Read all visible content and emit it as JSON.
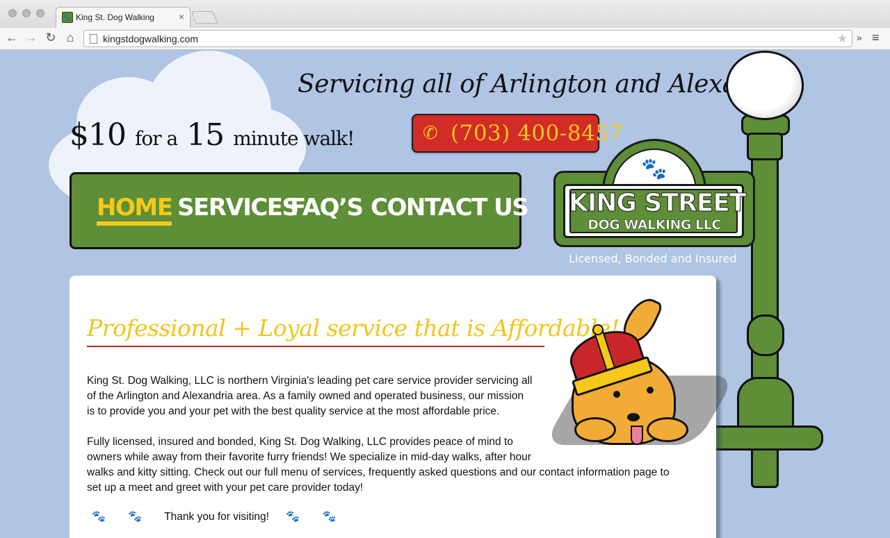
{
  "browser": {
    "tab_title": "King St. Dog Walking",
    "tab_close": "×",
    "url": "kingstdogwalking.com",
    "extensions_chevron": "»",
    "menu_icon": "≡"
  },
  "hero": {
    "price_amount": "$10",
    "price_for": "for a",
    "price_minutes": "15",
    "price_unit": "minute walk!",
    "servicing": "Servicing all of Arlington and Alexandria",
    "phone": "(703) 400-8457"
  },
  "nav": {
    "items": [
      {
        "label": "HOME",
        "active": true
      },
      {
        "label": "SERVICES",
        "active": false
      },
      {
        "label": "FAQ’S",
        "active": false
      },
      {
        "label": "CONTACT US",
        "active": false
      }
    ]
  },
  "logo": {
    "title": "KING STREET",
    "subtitle": "DOG WALKING LLC",
    "tagline": "Licensed, Bonded and Insured"
  },
  "content": {
    "headline": "Professional + Loyal service that is Affordable!",
    "para1": [
      "King St. Dog Walking, LLC is northern Virginia's leading pet care service provider servicing all",
      "of the Arlington and Alexandria area. As a family owned and operated business, our mission",
      "is to provide you and your pet with the best quality service at the most affordable price."
    ],
    "para2": [
      "Fully licensed, insured and bonded, King St. Dog Walking, LLC provides peace of mind to",
      "owners while away from their favorite furry friends! We specialize in mid-day walks, after hour",
      "walks and kitty sitting. Check out our full menu of services, frequently asked questions and our contact information page to",
      "set up a meet and greet with your pet care provider today!"
    ],
    "thanks": "Thank you for visiting!"
  },
  "colors": {
    "page_bg": "#b0c4e4",
    "nav_green": "#5e8e37",
    "accent_yellow": "#f6c81a",
    "phone_red": "#d12c27",
    "headline_rule": "#b8261f"
  },
  "icons": {
    "phone": "phone-icon",
    "paw": "paw-icon",
    "back": "back-arrow-icon",
    "forward": "forward-arrow-icon",
    "reload": "reload-icon",
    "home": "home-icon",
    "bookmark": "star-icon"
  }
}
